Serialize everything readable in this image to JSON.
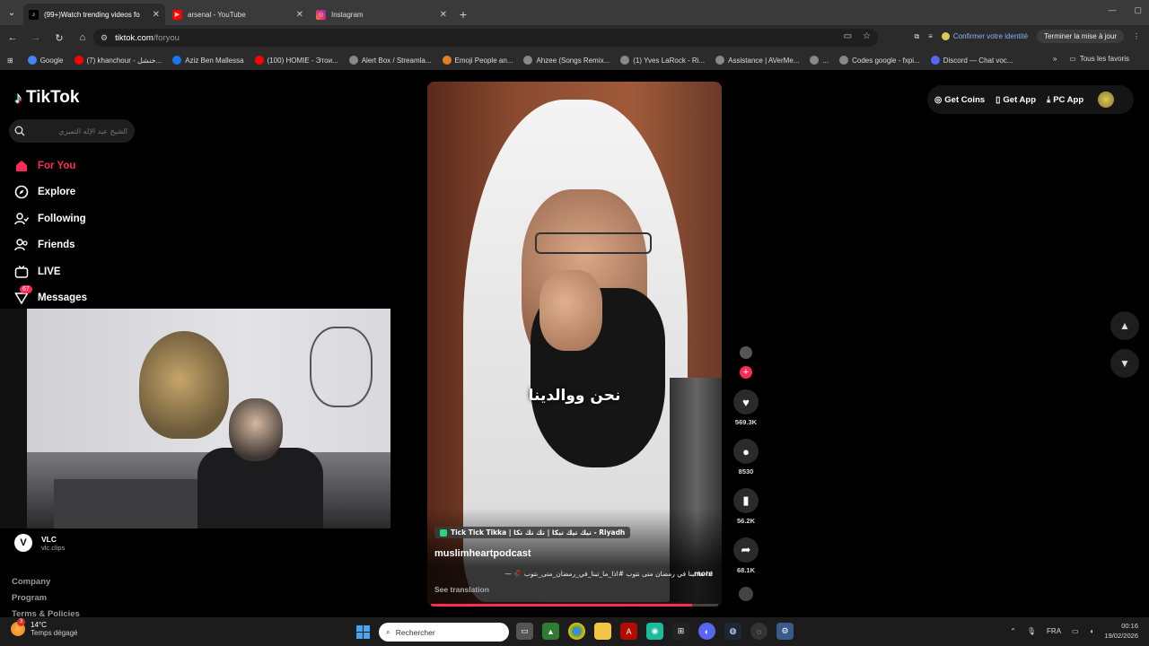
{
  "browser": {
    "tabs": [
      {
        "title": "(99+)Watch trending videos fo",
        "active": true,
        "icon": "tiktok-icon"
      },
      {
        "title": "arsenal - YouTube",
        "active": false,
        "icon": "youtube-icon"
      },
      {
        "title": "Instagram",
        "active": false,
        "icon": "instagram-icon"
      }
    ],
    "url_host": "tiktok.com",
    "url_path": "/foryou",
    "confirm_identity": "Confirmer votre identité",
    "update_label": "Terminer la mise à jour",
    "bookmarks": [
      {
        "label": "Google",
        "color": "#4285f4"
      },
      {
        "label": "(7) khanchour - خنشل...",
        "color": "#ff0000"
      },
      {
        "label": "Aziz Ben Mallessa",
        "color": "#1877f2"
      },
      {
        "label": "(100) HOMIE - Этои...",
        "color": "#ff0000"
      },
      {
        "label": "Alert Box / Streamla...",
        "color": "#888888"
      },
      {
        "label": "Emoji People an...",
        "color": "#e67e22"
      },
      {
        "label": "Ahzee (Songs Remix...",
        "color": "#888888"
      },
      {
        "label": "(1) Yves LaRock - Ri...",
        "color": "#888888"
      },
      {
        "label": "Assistance | AVerMe...",
        "color": "#888888"
      },
      {
        "label": "...",
        "color": "#888888"
      },
      {
        "label": "Codes google - fxpi...",
        "color": "#888888"
      },
      {
        "label": "Discord — Chat voc...",
        "color": "#5865f2"
      }
    ],
    "all_bookmarks": "Tous les favoris"
  },
  "tiktok": {
    "logo": "TikTok",
    "search_placeholder": "الشيخ عبد الإله التميري",
    "nav": [
      {
        "label": "For You",
        "icon": "home-icon",
        "active": true
      },
      {
        "label": "Explore",
        "icon": "compass-icon",
        "active": false
      },
      {
        "label": "Following",
        "icon": "following-icon",
        "active": false
      },
      {
        "label": "Friends",
        "icon": "friends-icon",
        "active": false
      },
      {
        "label": "LIVE",
        "icon": "live-icon",
        "active": false
      },
      {
        "label": "Messages",
        "icon": "messages-icon",
        "active": false
      }
    ],
    "messages_badge": "67",
    "vlc_name": "VLC",
    "vlc_handle": "vlc.clips",
    "footer": [
      "Company",
      "Program",
      "Terms & Policies"
    ],
    "top_right": {
      "coins": "Get Coins",
      "app": "Get App",
      "pc_app": "PC App"
    },
    "video": {
      "caption": "نحن ووالدينا",
      "tag": "Tick Tick Tikka | تيك تيك تيكا | تك تك تكا - Riyadh",
      "author": "muslimheartpodcast",
      "description": "اذا ما تبنا في رمضان متى نتوب #اذا_ما_تبنا_في_رمضان_متى_نتوب 🥀 — ",
      "more": "more",
      "see_translation": "See translation",
      "progress": 0.91
    },
    "actions": {
      "likes": "569.3K",
      "comments": "8530",
      "saves": "56.2K",
      "shares": "68.1K"
    }
  },
  "taskbar": {
    "temp": "14°C",
    "weather": "Temps dégagé",
    "weather_badge": "3",
    "search_placeholder": "Rechercher",
    "lang": "FRA",
    "time": "00:16",
    "date": "19/02/2026"
  }
}
